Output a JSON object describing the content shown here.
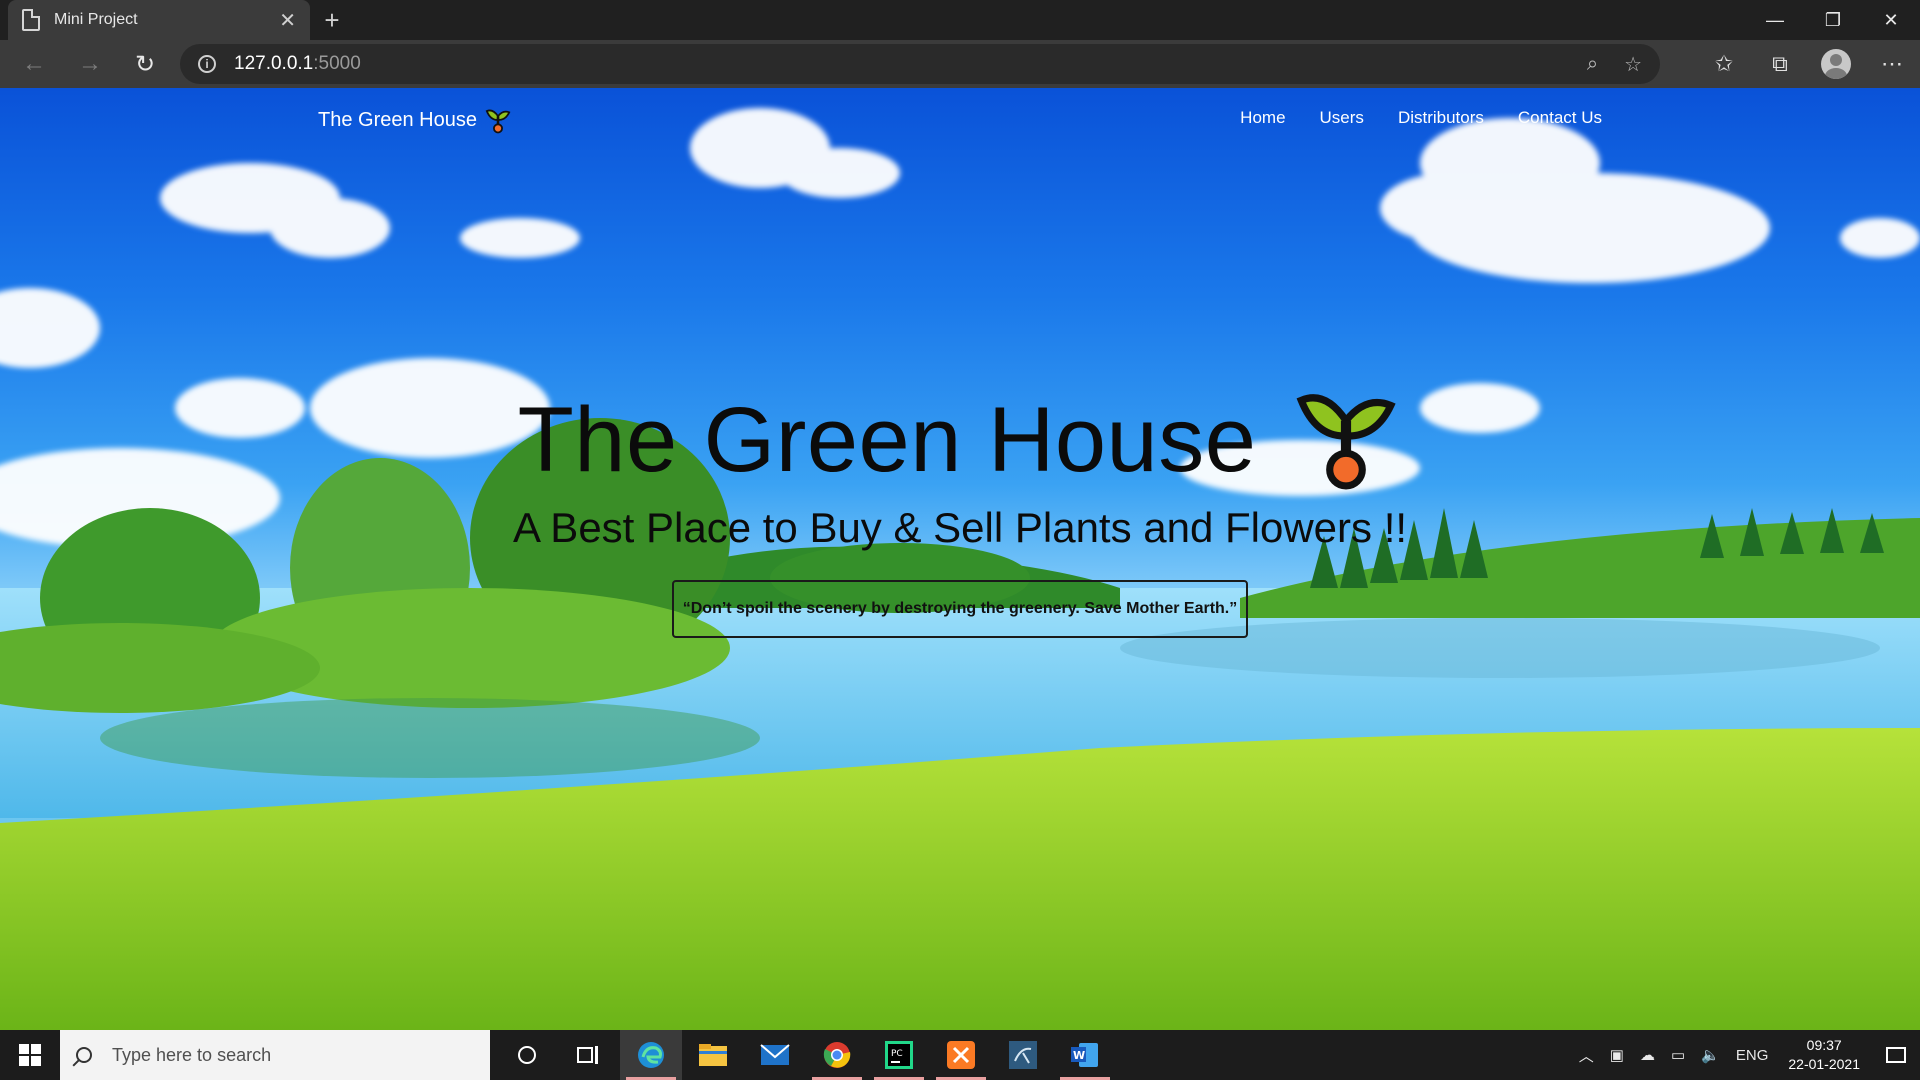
{
  "browser": {
    "tab_title": "Mini Project",
    "tab_close": "✕",
    "new_tab": "+",
    "address_host": "127.0.0.1",
    "address_port": ":5000",
    "window_controls": {
      "minimize": "—",
      "restore": "❐",
      "close": "✕"
    }
  },
  "site": {
    "brand": "The Green House",
    "nav": [
      "Home",
      "Users",
      "Distributors",
      "Contact Us"
    ],
    "hero_title": "The Green House",
    "hero_subtitle": "A Best Place to Buy & Sell Plants and Flowers !!",
    "quote": "“Don’t spoil the scenery by destroying the greenery. Save Mother Earth.”"
  },
  "taskbar": {
    "search_placeholder": "Type here to search",
    "tray_language": "ENG",
    "time": "09:37",
    "date": "22-01-2021"
  },
  "colors": {
    "sky_top": "#0a52d8",
    "chrome_dark": "#202020",
    "chrome_toolbar": "#3b3b3b",
    "sprout_green": "#8fc31f",
    "sprout_seed": "#f26b2a"
  }
}
